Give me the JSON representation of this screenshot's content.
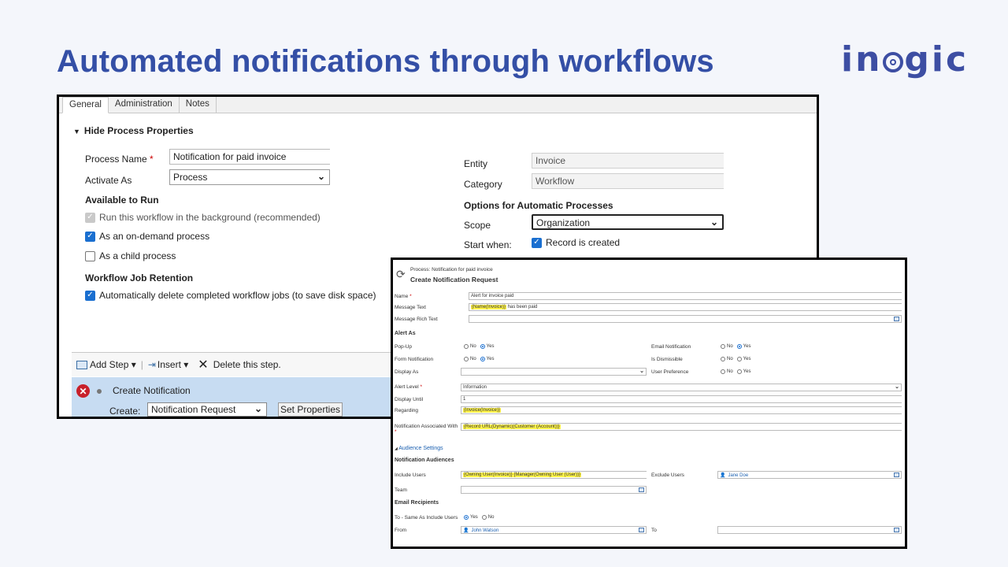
{
  "slide_title": "Automated notifications through workflows",
  "logo_text": "inogic",
  "panel1": {
    "tabs": [
      "General",
      "Administration",
      "Notes"
    ],
    "section_header": "Hide Process Properties",
    "process_name_label": "Process Name",
    "required_mark": "*",
    "process_name_value": "Notification for paid invoice",
    "activate_as_label": "Activate As",
    "activate_as_value": "Process",
    "available_to_run": "Available to Run",
    "cb_background": "Run this workflow in the background (recommended)",
    "cb_on_demand": "As an on-demand process",
    "cb_child": "As a child process",
    "workflow_job_retention": "Workflow Job Retention",
    "cb_auto_delete": "Automatically delete completed workflow jobs (to save disk space)",
    "entity_label": "Entity",
    "entity_value": "Invoice",
    "category_label": "Category",
    "category_value": "Workflow",
    "options_header": "Options for Automatic Processes",
    "scope_label": "Scope",
    "scope_value": "Organization",
    "start_when_label": "Start when:",
    "cb_record_created": "Record is created",
    "toolbar": {
      "add_step": "Add Step",
      "insert": "Insert",
      "delete": "Delete this step."
    },
    "step": {
      "title": "Create Notification",
      "create_label": "Create:",
      "create_value": "Notification Request",
      "set_properties": "Set Properties"
    }
  },
  "panel2": {
    "process_line": "Process: Notification for paid invoice",
    "title": "Create Notification Request",
    "name_label": "Name",
    "name_value": "Alert for invoice paid",
    "message_text_label": "Message Text",
    "message_text_highlight": "{Name(Invoice)}",
    "message_text_rest": " has been paid",
    "message_rich_label": "Message Rich Text",
    "alert_as": "Alert As",
    "popup_label": "Pop-Up",
    "form_notification_label": "Form Notification",
    "display_as_label": "Display As",
    "email_notification_label": "Email Notification",
    "is_dismissible_label": "Is Dismissible",
    "user_preference_label": "User Preference",
    "no": "No",
    "yes": "Yes",
    "alert_level_label": "Alert Level",
    "alert_level_value": "Information",
    "display_until_label": "Display Until",
    "display_until_value": "1",
    "regarding_label": "Regarding",
    "regarding_value": "{Invoice(Invoice)}",
    "notification_assoc_label": "Notification Associated With",
    "notification_assoc_value": "{Record URL(Dynamic)(Customer (Account))}",
    "audience_settings": "Audience Settings",
    "notification_audiences": "Notification Audiences",
    "include_users_label": "Include Users",
    "include_users_value": "{Owning User(Invoice)} {Manager(Owning User (User))}",
    "exclude_users_label": "Exclude Users",
    "exclude_users_value": "Jane Doe",
    "team_label": "Team",
    "email_recipients": "Email Recipients",
    "to_same_label": "To - Same As Include Users",
    "from_label": "From",
    "from_value": "John Watson",
    "to_label": "To"
  }
}
